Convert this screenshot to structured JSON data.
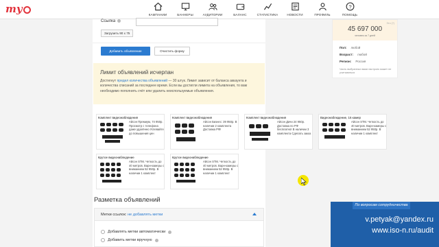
{
  "logo": {
    "text": "my"
  },
  "nav": [
    {
      "icon": "home-icon",
      "label": "Кампании"
    },
    {
      "icon": "monitor-icon",
      "label": "Баннеры"
    },
    {
      "icon": "users-icon",
      "label": "Аудитории"
    },
    {
      "icon": "wallet-icon",
      "label": "Баланс"
    },
    {
      "icon": "stats-icon",
      "label": "Статистика"
    },
    {
      "icon": "news-icon",
      "label": "Новости"
    },
    {
      "icon": "profile-icon",
      "label": "Профиль"
    },
    {
      "icon": "help-icon",
      "label": "Помощь"
    }
  ],
  "form": {
    "link_label": "Ссылка",
    "link_value": "",
    "upload_label": "Загрузить 90 x 75",
    "add_label": "Добавить объявление",
    "reset_label": "Очистить форму"
  },
  "limit": {
    "title": "Лимит объявлений исчерпан",
    "text_before": "Достигнут ",
    "link_text": "предел количества объявлений",
    "text_after": " — 30 штук. Лимит зависит от баланса аккаунта и количества списаний за последнее время. Если вы достигли лимита на объявления, то вам необходимо пополнить счёт или удалить неиспользуемые объявления."
  },
  "ads": [
    {
      "title": "Комплект видеонаблюдения",
      "text": "Айсон Премиум, 74 950р. Просмотр с телефона даже удалённо Успевайте до повышения цен"
    },
    {
      "title": "Комплект видеонаблюдения",
      "text": "Айсон Бизнес: 39 950р. В наличии 2 комплекта Доставка РФ!"
    },
    {
      "title": "Комплект видеонаблюдения",
      "text": "Айсон Дачи 24 950р. Доставка по РФ бесплатно! В наличии 3 комплекта Сделать заказ"
    },
    {
      "title": "Видеонаблюдение, 16 камер",
      "text": "Айсон STM. Четкость до 40 метров. Варн-камеры с вниманием 52 950р. В наличии 1 комплект"
    },
    {
      "title": "Крутое видеонаблюдение",
      "text": "Айсон STM. Четкость до 40 метров. Варн-камеры с вниманием 52 950р. В наличии 1 комплект"
    },
    {
      "title": "Крутое видеонаблюдение",
      "text": "Айсон STM. Четкость до 40 метров. Варн-камеры с вниманием 52 950р. В наличии 1 комплект"
    }
  ],
  "markup": {
    "title": "Разметка объявлений",
    "head_label": "Метки ссылок: ",
    "head_link": "не добавлять метки",
    "options": [
      "Добавлять метки автоматически",
      "Добавить метки вручную"
    ]
  },
  "audience": {
    "reach": "45 697 000",
    "reach_sub": "человек за 7 дней",
    "hint": "Это (?)",
    "params": [
      {
        "key": "Пол:",
        "value": "любой"
      },
      {
        "key": "Возраст:",
        "value": "любой"
      },
      {
        "key": "Регион:",
        "value": "Россия"
      }
    ],
    "note": "Часть выбранных вами настроек может не учитываться"
  },
  "contact": {
    "header": "По вопросам сотрудничества",
    "email": "v.petyak@yandex.ru",
    "site": "www.iso-n.ru/audit"
  },
  "colors": {
    "accent": "#2b7bd0",
    "brand": "#e2323b",
    "contact_bg": "#1f5fa8",
    "notice_bg": "#fdf6dd"
  }
}
